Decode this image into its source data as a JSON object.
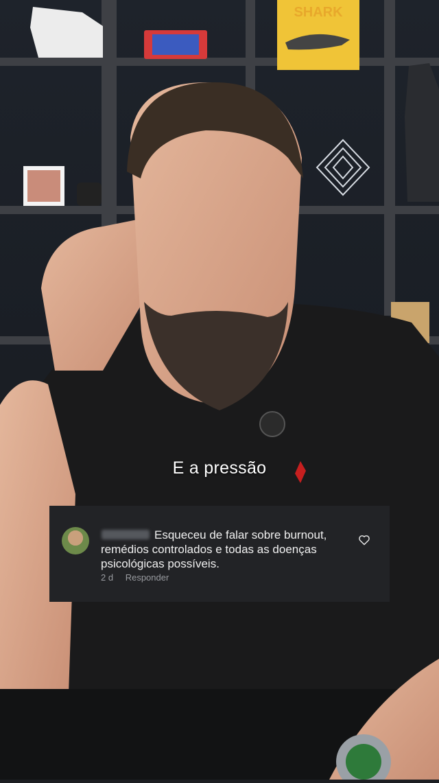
{
  "video": {
    "caption": "E a pressão",
    "background_art": {
      "poster_text": "SHARK"
    }
  },
  "comment": {
    "text": "Esqueceu de falar sobre burnout, remédios controlados e todas as doenças psicológicas possíveis.",
    "time": "2 d",
    "reply_label": "Responder",
    "icons": {
      "avatar": "avatar",
      "like": "heart-icon"
    }
  },
  "colors": {
    "card_bg": "#222326",
    "text": "#f1f1f1",
    "meta": "#9a9ca1"
  }
}
